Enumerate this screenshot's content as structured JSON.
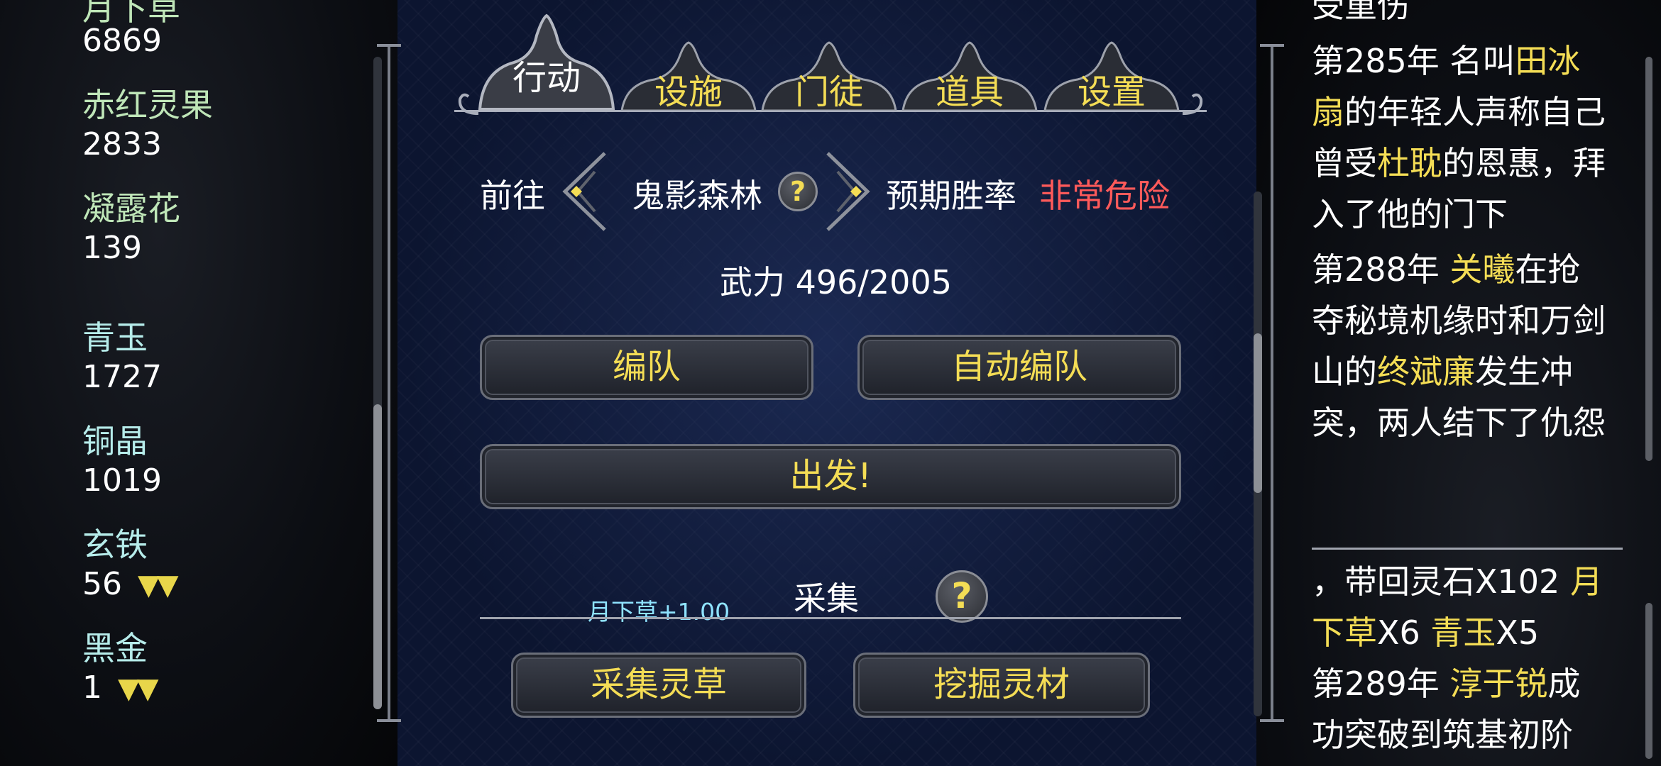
{
  "left_panel": {
    "cut_label": "月下草",
    "items": [
      {
        "name": "",
        "value": "6869",
        "trend": ""
      },
      {
        "name": "赤红灵果",
        "value": "2833",
        "trend": ""
      },
      {
        "name": "凝露花",
        "value": "139",
        "trend": ""
      },
      {
        "name": "青玉",
        "value": "1727",
        "trend": ""
      },
      {
        "name": "铜晶",
        "value": "1019",
        "trend": ""
      },
      {
        "name": "玄铁",
        "value": "56",
        "trend": "▼▼"
      },
      {
        "name": "黑金",
        "value": "1",
        "trend": "▼▼"
      }
    ]
  },
  "tabs": [
    {
      "label": "行动",
      "active": true
    },
    {
      "label": "设施",
      "active": false
    },
    {
      "label": "门徒",
      "active": false
    },
    {
      "label": "道具",
      "active": false
    },
    {
      "label": "设置",
      "active": false
    }
  ],
  "expedition": {
    "goto_label": "前往",
    "location": "鬼影森林",
    "help_symbol": "?",
    "win_rate_label": "预期胜率",
    "win_rate_value": "非常危险",
    "power_label": "武力 496/2005"
  },
  "buttons": {
    "formation": "编队",
    "auto_formation": "自动编队",
    "depart": "出发!"
  },
  "gather": {
    "title": "采集",
    "floating_text": "月下草+1.00",
    "help_symbol": "?",
    "gather_herb": "采集灵草",
    "dig_material": "挖掘灵材"
  },
  "log_top": {
    "cut_text": "受重伤",
    "entries": [
      [
        {
          "t": "第285年 名叫",
          "h": false
        },
        {
          "t": "田冰扇",
          "h": true
        },
        {
          "t": "的年轻人声称自己曾受",
          "h": false
        },
        {
          "t": "杜耽",
          "h": true
        },
        {
          "t": "的恩惠，拜入了他的门下",
          "h": false
        }
      ],
      [
        {
          "t": "第288年 ",
          "h": false
        },
        {
          "t": "关曦",
          "h": true
        },
        {
          "t": "在抢夺秘境机缘时和万剑山的",
          "h": false
        },
        {
          "t": "终斌廉",
          "h": true
        },
        {
          "t": "发生冲突，两人结下了仇怨",
          "h": false
        }
      ]
    ]
  },
  "log_bottom": {
    "entries": [
      [
        {
          "t": "，带回灵石X102 ",
          "h": false
        },
        {
          "t": "月下草",
          "h": true
        },
        {
          "t": "X6 ",
          "h": false
        },
        {
          "t": "青玉",
          "h": true
        },
        {
          "t": "X5",
          "h": false
        }
      ],
      [
        {
          "t": "第289年 ",
          "h": false
        },
        {
          "t": "淳于锐",
          "h": true
        },
        {
          "t": "成功突破到筑基初阶",
          "h": false
        }
      ]
    ]
  },
  "colors": {
    "accent_yellow": "#f4dd55",
    "danger_red": "#ff5a5a",
    "resource_green": "#bfe6b8"
  }
}
